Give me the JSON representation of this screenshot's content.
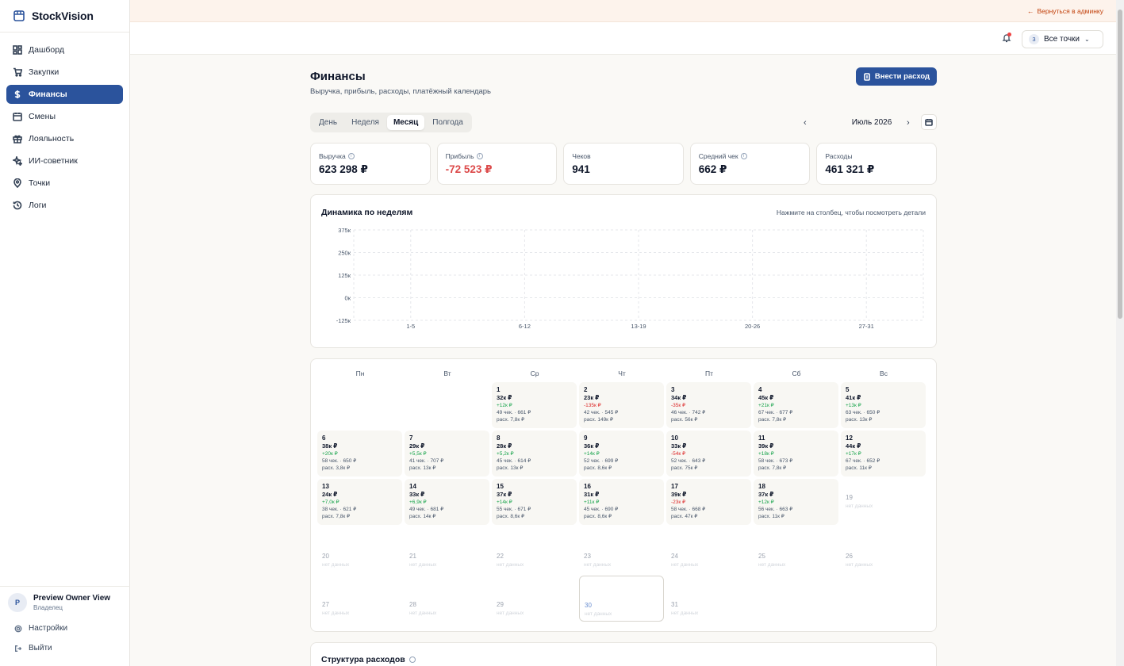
{
  "app": {
    "name": "StockVision"
  },
  "sidebar": {
    "items": [
      {
        "label": "Дашборд",
        "icon": "dashboard-icon",
        "active": false
      },
      {
        "label": "Закупки",
        "icon": "cart-icon",
        "active": false
      },
      {
        "label": "Финансы",
        "icon": "dollar-icon",
        "active": true
      },
      {
        "label": "Смены",
        "icon": "calendar-icon",
        "active": false
      },
      {
        "label": "Лояльность",
        "icon": "gift-icon",
        "active": false
      },
      {
        "label": "ИИ-советник",
        "icon": "sparkles-icon",
        "active": false
      },
      {
        "label": "Точки",
        "icon": "map-pin-icon",
        "active": false
      },
      {
        "label": "Логи",
        "icon": "history-icon",
        "active": false
      }
    ],
    "user": {
      "initial": "P",
      "name": "Preview Owner View",
      "role": "Владелец"
    },
    "settings_label": "Настройки",
    "logout_label": "Выйти"
  },
  "banner": {
    "back_label": "Вернуться в админку"
  },
  "header": {
    "points_count": "3",
    "points_label": "Все точки"
  },
  "page": {
    "title": "Финансы",
    "subtitle": "Выручка, прибыль, расходы, платёжный календарь",
    "add_expense_label": "Внести расход",
    "tabs": [
      "День",
      "Неделя",
      "Месяц",
      "Полгода"
    ],
    "active_tab": 2,
    "period": "Июль 2026"
  },
  "kpis": [
    {
      "label": "Выручка",
      "value": "623 298 ₽",
      "info": true,
      "negative": false
    },
    {
      "label": "Прибыль",
      "value": "-72 523 ₽",
      "info": true,
      "negative": true
    },
    {
      "label": "Чеков",
      "value": "941",
      "info": false,
      "negative": false
    },
    {
      "label": "Средний чек",
      "value": "662 ₽",
      "info": true,
      "negative": false
    },
    {
      "label": "Расходы",
      "value": "461 321 ₽",
      "info": false,
      "negative": false
    }
  ],
  "chart_data": {
    "type": "bar",
    "title": "Динамика по неделям",
    "hint": "Нажмите на столбец, чтобы посмотреть детали",
    "categories": [
      "1-5",
      "6-12",
      "13-19",
      "20-26",
      "27-31"
    ],
    "yticks": [
      "375к",
      "250к",
      "125к",
      "0к",
      "-125к"
    ],
    "ylim": [
      -125000,
      375000
    ],
    "grid": true
  },
  "calendar": {
    "weekdays": [
      "Пн",
      "Вт",
      "Ср",
      "Чт",
      "Пт",
      "Сб",
      "Вс"
    ],
    "start_offset": 2,
    "no_data_label": "нет данных",
    "today": 30,
    "days": [
      {
        "d": "1",
        "rev": "32к ₽",
        "prof": "+12к ₽",
        "pos": true,
        "checks": "49 чек. · 661 ₽",
        "exp": "расх. 7,8к ₽"
      },
      {
        "d": "2",
        "rev": "23к ₽",
        "prof": "-135к ₽",
        "pos": false,
        "checks": "42 чек. · 545 ₽",
        "exp": "расх. 149к ₽"
      },
      {
        "d": "3",
        "rev": "34к ₽",
        "prof": "-35к ₽",
        "pos": false,
        "checks": "46 чек. · 742 ₽",
        "exp": "расх. 56к ₽"
      },
      {
        "d": "4",
        "rev": "45к ₽",
        "prof": "+21к ₽",
        "pos": true,
        "checks": "67 чек. · 677 ₽",
        "exp": "расх. 7,8к ₽"
      },
      {
        "d": "5",
        "rev": "41к ₽",
        "prof": "+13к ₽",
        "pos": true,
        "checks": "63 чек. · 650 ₽",
        "exp": "расх. 13к ₽"
      },
      {
        "d": "6",
        "rev": "38к ₽",
        "prof": "+20к ₽",
        "pos": true,
        "checks": "58 чек. · 650 ₽",
        "exp": "расх. 3,8к ₽"
      },
      {
        "d": "7",
        "rev": "29к ₽",
        "prof": "+5,5к ₽",
        "pos": true,
        "checks": "41 чек. · 707 ₽",
        "exp": "расх. 13к ₽"
      },
      {
        "d": "8",
        "rev": "28к ₽",
        "prof": "+5,2к ₽",
        "pos": true,
        "checks": "45 чек. · 614 ₽",
        "exp": "расх. 13к ₽"
      },
      {
        "d": "9",
        "rev": "36к ₽",
        "prof": "+14к ₽",
        "pos": true,
        "checks": "52 чек. · 699 ₽",
        "exp": "расх. 8,6к ₽"
      },
      {
        "d": "10",
        "rev": "33к ₽",
        "prof": "-54к ₽",
        "pos": false,
        "checks": "52 чек. · 643 ₽",
        "exp": "расх. 75к ₽"
      },
      {
        "d": "11",
        "rev": "39к ₽",
        "prof": "+18к ₽",
        "pos": true,
        "checks": "58 чек. · 673 ₽",
        "exp": "расх. 7,8к ₽"
      },
      {
        "d": "12",
        "rev": "44к ₽",
        "prof": "+17к ₽",
        "pos": true,
        "checks": "67 чек. · 652 ₽",
        "exp": "расх. 11к ₽"
      },
      {
        "d": "13",
        "rev": "24к ₽",
        "prof": "+7,0к ₽",
        "pos": true,
        "checks": "38 чек. · 621 ₽",
        "exp": "расх. 7,8к ₽"
      },
      {
        "d": "14",
        "rev": "33к ₽",
        "prof": "+6,9к ₽",
        "pos": true,
        "checks": "49 чек. · 681 ₽",
        "exp": "расх. 14к ₽"
      },
      {
        "d": "15",
        "rev": "37к ₽",
        "prof": "+14к ₽",
        "pos": true,
        "checks": "55 чек. · 671 ₽",
        "exp": "расх. 8,6к ₽"
      },
      {
        "d": "16",
        "rev": "31к ₽",
        "prof": "+11к ₽",
        "pos": true,
        "checks": "45 чек. · 690 ₽",
        "exp": "расх. 8,6к ₽"
      },
      {
        "d": "17",
        "rev": "39к ₽",
        "prof": "-23к ₽",
        "pos": false,
        "checks": "58 чек. · 668 ₽",
        "exp": "расх. 47к ₽"
      },
      {
        "d": "18",
        "rev": "37к ₽",
        "prof": "+12к ₽",
        "pos": true,
        "checks": "56 чек. · 663 ₽",
        "exp": "расх. 11к ₽"
      },
      {
        "d": "19"
      },
      {
        "d": "20"
      },
      {
        "d": "21"
      },
      {
        "d": "22"
      },
      {
        "d": "23"
      },
      {
        "d": "24"
      },
      {
        "d": "25"
      },
      {
        "d": "26"
      },
      {
        "d": "27"
      },
      {
        "d": "28"
      },
      {
        "d": "29"
      },
      {
        "d": "30"
      },
      {
        "d": "31"
      }
    ]
  },
  "structure": {
    "title": "Структура расходов"
  }
}
